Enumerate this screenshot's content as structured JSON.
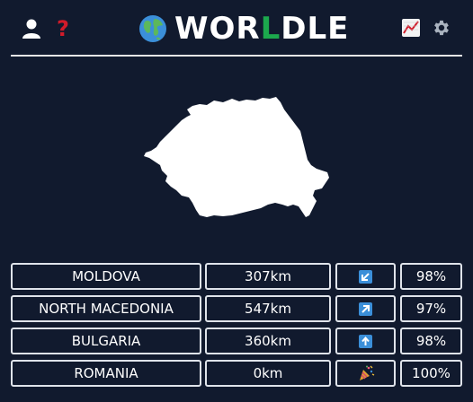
{
  "header": {
    "title_prefix": "WOR",
    "title_accent": "L",
    "title_suffix": "DLE",
    "help_glyph": "?",
    "accent_color": "#1ca84d"
  },
  "icons": {
    "left": [
      "user-icon",
      "help-icon"
    ],
    "right": [
      "stats-chart-icon",
      "gear-icon"
    ],
    "title": "globe-icon"
  },
  "guesses": [
    {
      "country": "MOLDOVA",
      "distance": "307km",
      "direction": "southwest-arrow-icon",
      "percent": "98%"
    },
    {
      "country": "NORTH MACEDONIA",
      "distance": "547km",
      "direction": "northeast-arrow-icon",
      "percent": "97%"
    },
    {
      "country": "BULGARIA",
      "distance": "360km",
      "direction": "up-arrow-icon",
      "percent": "98%"
    },
    {
      "country": "ROMANIA",
      "distance": "0km",
      "direction": "party-popper-icon",
      "percent": "100%"
    }
  ]
}
